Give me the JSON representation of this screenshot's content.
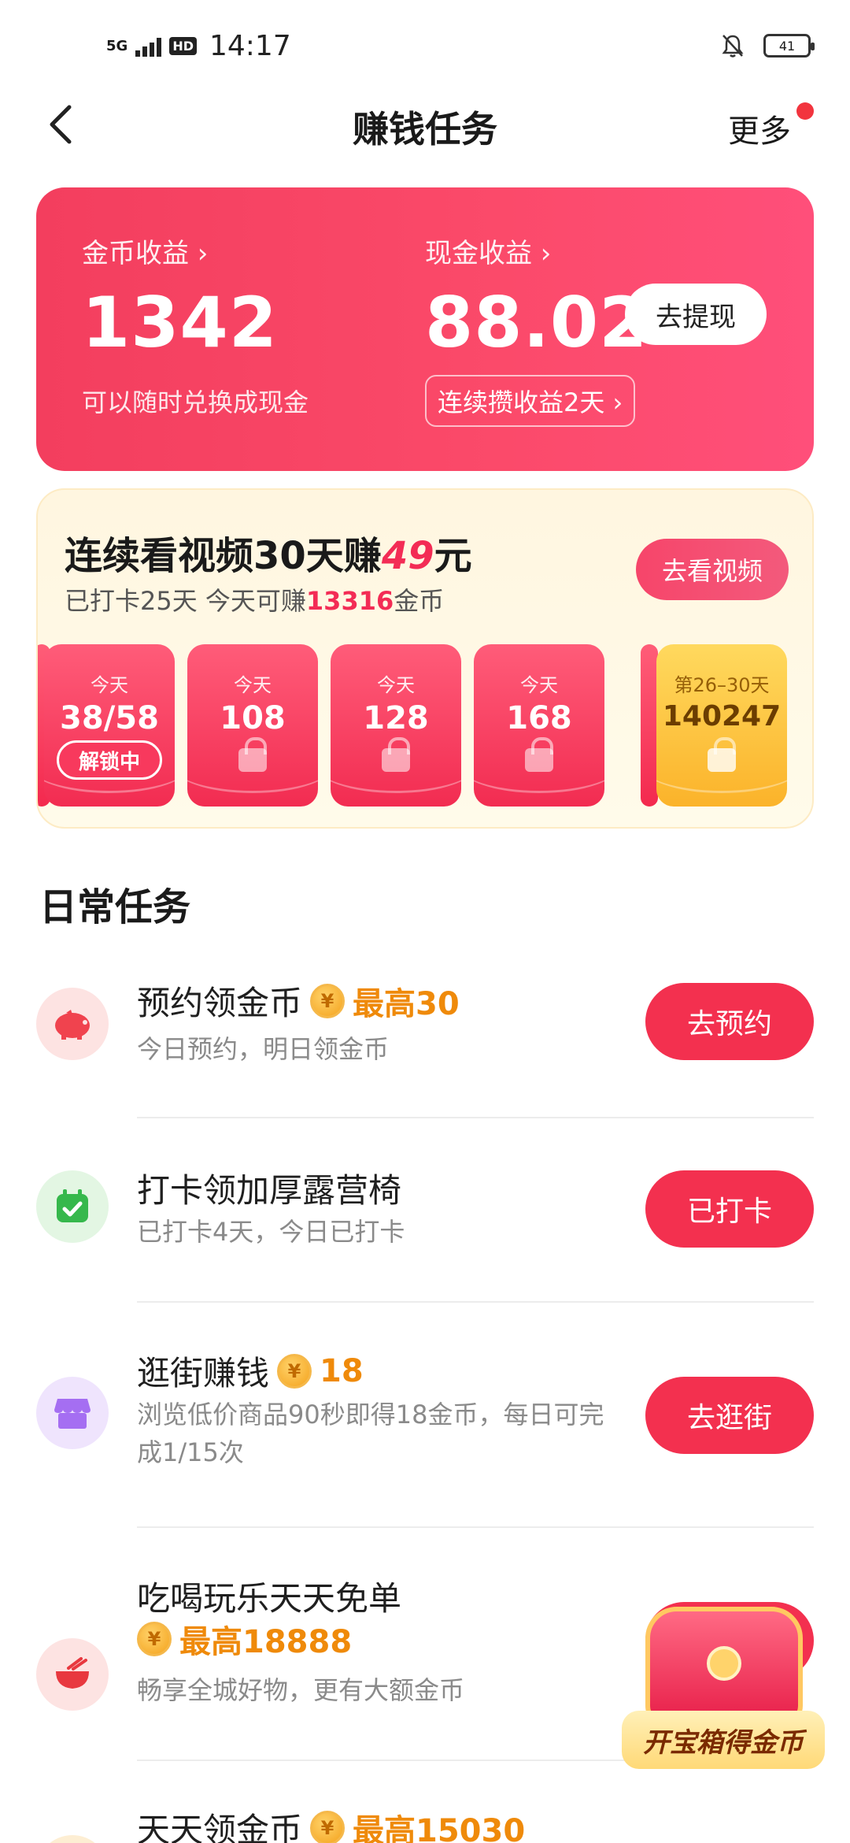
{
  "status": {
    "network": "5G",
    "hd": "HD",
    "time": "14:17",
    "battery": "41"
  },
  "nav": {
    "title": "赚钱任务",
    "more": "更多"
  },
  "earnings": {
    "coin_label": "金币收益 ›",
    "coin_value": "1342",
    "coin_sub": "可以随时兑换成现金",
    "cash_label": "现金收益 ›",
    "cash_value": "88.02",
    "streak_chip": "连续攒收益2天 ›",
    "withdraw_button": "去提现"
  },
  "streak": {
    "title_pre": "连续看视频30天赚",
    "title_amount": "49",
    "title_post": "元",
    "sub_pre": "已打卡25天 今天可赚",
    "sub_amount": "13316",
    "sub_post": "金币",
    "watch_button": "去看视频",
    "days": [
      {
        "tag": "今天",
        "value": "38/58",
        "badge": "解锁中"
      },
      {
        "tag": "今天",
        "value": "108"
      },
      {
        "tag": "今天",
        "value": "128"
      },
      {
        "tag": "今天",
        "value": "168"
      },
      {
        "tag": "第26–30天",
        "value": "140247"
      }
    ]
  },
  "daily": {
    "title": "日常任务",
    "tasks": [
      {
        "title": "预约领金币",
        "coin": "¥",
        "reward": "最高30",
        "desc": "今日预约，明日领金币",
        "button": "去预约"
      },
      {
        "title": "打卡领加厚露营椅",
        "desc": "已打卡4天，今日已打卡",
        "button": "已打卡"
      },
      {
        "title": "逛街赚钱",
        "coin": "¥",
        "reward": "18",
        "desc": "浏览低价商品90秒即得18金币，每日可完成1/15次",
        "button": "去逛街"
      },
      {
        "title": "吃喝玩乐天天免单",
        "coin": "¥",
        "reward": "最高18888",
        "desc": "畅享全城好物，更有大额金币"
      },
      {
        "title": "天天领金币",
        "coin": "¥",
        "reward": "最高15030"
      }
    ]
  },
  "chest": {
    "label": "开宝箱得金币"
  },
  "colors": {
    "accent": "#f3304f",
    "reward": "#ef8a0a",
    "gold": "#fbb32a"
  }
}
